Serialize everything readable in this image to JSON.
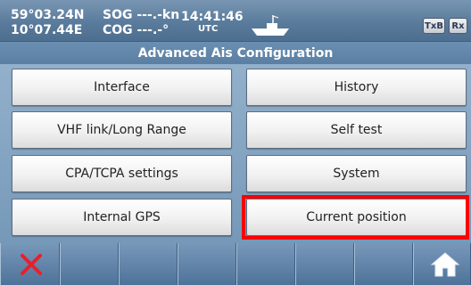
{
  "status": {
    "latitude": "59°03.24N",
    "longitude": "10°07.44E",
    "sog": "SOG ---.-kn",
    "cog": "COG ---.-°",
    "time": "14:41:46",
    "timezone": "UTC",
    "tx_badge": "TxB",
    "rx_badge": "Rx",
    "vessel_icon": "ship-icon"
  },
  "title": "Advanced Ais Configuration",
  "menu": {
    "interface": "Interface",
    "history": "History",
    "vhf": "VHF link/Long Range",
    "self_test": "Self test",
    "cpa": "CPA/TCPA settings",
    "system": "System",
    "internal_gps": "Internal GPS",
    "current_position": "Current position"
  },
  "toolbar": {
    "close_icon": "close-icon",
    "home_icon": "home-icon"
  },
  "colors": {
    "highlight": "#ff0000",
    "close_x": "#e8202a",
    "header_bg": "#5a7b9b",
    "toolbar_bg": "#5b80a6"
  }
}
